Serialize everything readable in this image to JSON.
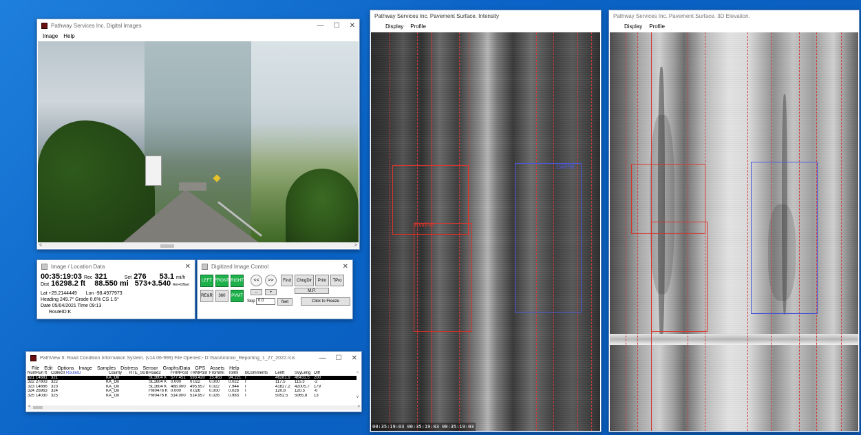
{
  "digital_window": {
    "title": "Pathway Services Inc. Digital Images",
    "menu": [
      "Image",
      "Help"
    ]
  },
  "location_window": {
    "title": "Image / Location Data",
    "time": "00:35:19:03",
    "rec_label": "Rec",
    "rec_value": "321",
    "set_label": "Set",
    "set_value": "276",
    "speed_value": "53.1",
    "speed_unit": "mi/h",
    "dist_label": "Dist",
    "dist_value": "16298.2 ft",
    "mi_value": "88.550 mi",
    "rel_value": "573+3.540",
    "rel_unit": "Rel+Offset",
    "lat": "Lat +29.2144449",
    "lon": "Lon -98.4977973",
    "heading": "Heading 249.7°  Grade 0.6%  CS 1.5°",
    "date": "Date 05/04/2021   Time 09:13",
    "route": "RouteID:K"
  },
  "control_window": {
    "title": "Digitized Image Control",
    "buttons": {
      "left": "LEFT",
      "front": "FRONT",
      "right": "RIGHT",
      "rear": "RE&R",
      "deg360": "360",
      "pave": "PVMT",
      "prev": "<<",
      "next": ">>",
      "find": "Find",
      "chng": "ChngDir",
      "print": "Print",
      "tpro": "TPro",
      "mp": "M.P.",
      "minus": "--",
      "plus": "+",
      "freeze": "Click to Freeze"
    },
    "skip_label": "Skip",
    "skip_value": "0.0",
    "feet_label": "feet"
  },
  "pathview_window": {
    "title": "PathView II: Road Condition Information System. (v14.06-999)  File Opened:- D:\\SanAntonio_Reporting_1_27_2022.rcis",
    "menu": [
      "File",
      "Edit",
      "Options",
      "Image",
      "Samples",
      "Distress",
      "Sensor",
      "Graphs/Data",
      "GPS",
      "Assets",
      "Help"
    ],
    "columns": [
      "Num",
      "Run ft",
      "CollectI",
      "RouteID",
      "County",
      "RTE_SUB",
      "Road2",
      "FRMPost",
      "TRMPost",
      "Fromlmi",
      "Tolmi",
      "BComments",
      "Lenft",
      "SvyLeng",
      "Diff"
    ],
    "rows": [
      [
        "321",
        "14681",
        "321",
        "K",
        "A_On",
        "",
        "SL1604 K",
        "577.451",
        "593.420",
        "15.463",
        "94.221",
        "I",
        "46281.9",
        "46431.5",
        "200"
      ],
      [
        "322",
        "27803",
        "322",
        "K",
        "A_On",
        "",
        "SL1604 K",
        "0.000",
        "0.022",
        "0.000",
        "0.022",
        "I",
        "117.5",
        "115.3",
        "-2"
      ],
      [
        "323",
        "14666",
        "323",
        "K",
        "A_On",
        "",
        "SL1604 K",
        "488.000",
        "495.957",
        "0.022",
        "7.944",
        "I",
        "41827.2",
        "42005.7",
        "179"
      ],
      [
        "324",
        "26963",
        "324",
        "K",
        "A_On",
        "",
        "FM0476 K",
        "0.000",
        "0.026",
        "0.000",
        "0.026",
        "I",
        "120.8",
        "120.5",
        "-0"
      ],
      [
        "325",
        "14030",
        "325",
        "K",
        "A_On",
        "",
        "FM0476 K",
        "514.000",
        "514.957",
        "0.026",
        "0.983",
        "I",
        "5052.5",
        "5065.8",
        "13"
      ]
    ]
  },
  "intensity_window": {
    "title": "Pathway Services Inc. Pavement Surface. Intensity",
    "menu": [
      "Display",
      "Profile"
    ],
    "label_red": "RWPM",
    "label_blue": "LWPM",
    "timeline": "00:35:19:03  00:35:19:03  00:35:19:03"
  },
  "elevation_window": {
    "title": "Pathway Services Inc. Pavement Surface. 3D Elevation.",
    "menu": [
      "Display",
      "Profile"
    ]
  },
  "colors": {
    "desktop": "#0b63c6",
    "red_box": "#d9342b",
    "blue_box": "#4a56d8",
    "green_button": "#1eb04b"
  }
}
